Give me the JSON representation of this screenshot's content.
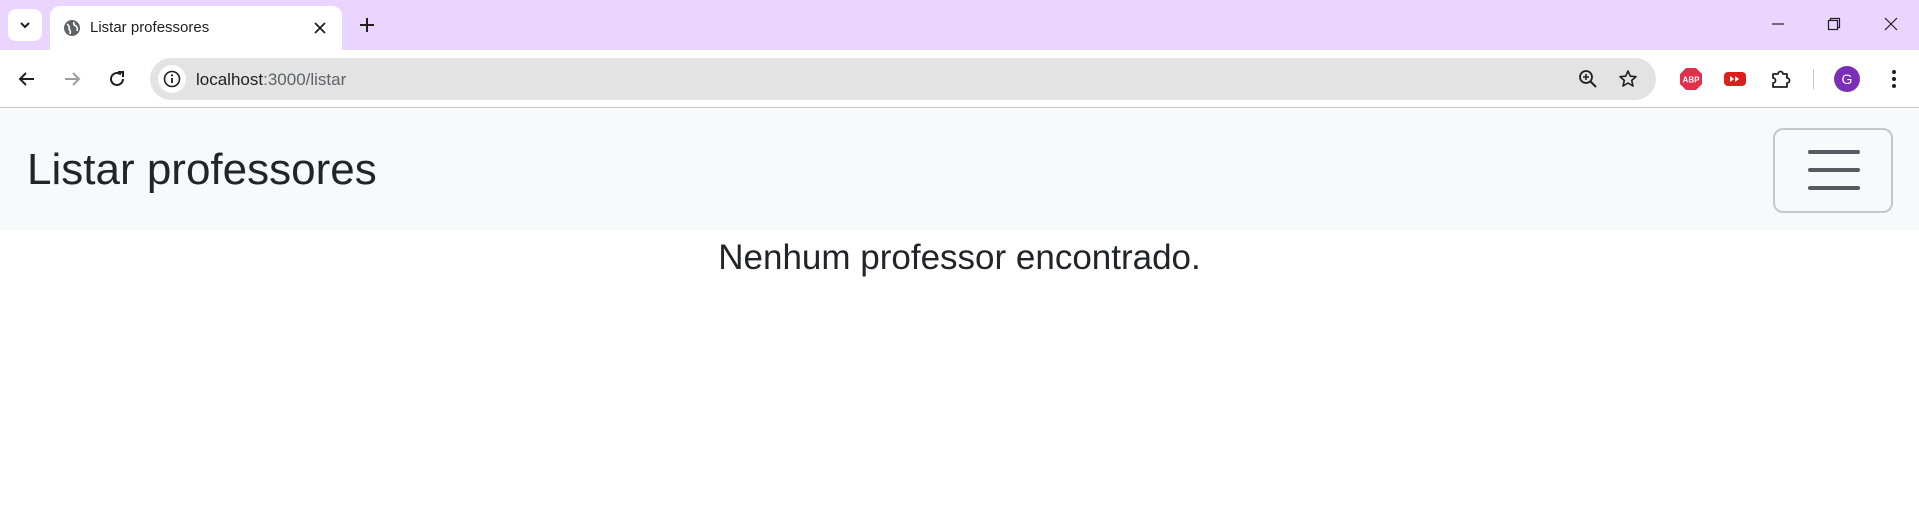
{
  "browser": {
    "tab": {
      "title": "Listar professores"
    },
    "url": {
      "host": "localhost",
      "path": ":3000/listar"
    },
    "profile_initial": "G",
    "extensions": [
      "adblock-plus-icon",
      "youtube-extension-icon",
      "extensions-puzzle-icon"
    ]
  },
  "page": {
    "brand": "Listar professores",
    "empty_message": "Nenhum professor encontrado."
  },
  "colors": {
    "tabstrip": "#e9d5ff",
    "navbar": "#f8f9fa",
    "avatar": "#7b2fb6",
    "text": "#212529"
  }
}
